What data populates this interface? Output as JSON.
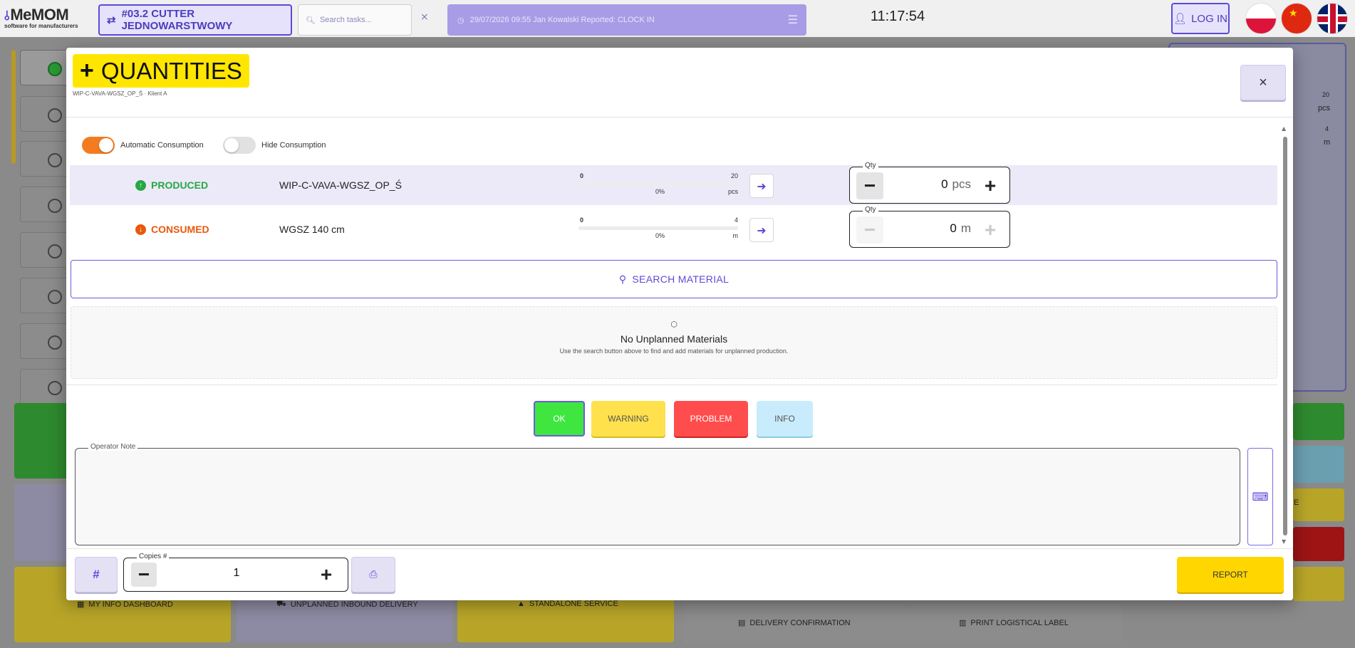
{
  "topbar": {
    "logo_brand": "MeMOM",
    "logo_tagline": "software for manufacturers",
    "workstation_label": "#03.2 CUTTER JEDNOWARSTWOWY",
    "search_placeholder": "Search tasks...",
    "notice_text": "29/07/2026 09:55 Jan Kowalski Reported: CLOCK IN",
    "clock": "11:17:54",
    "login_label": "LOG IN"
  },
  "background": {
    "right_panel_values": [
      "20",
      "pcs",
      "4",
      "m"
    ],
    "tiles": {
      "my_info_dashboard": "MY INFO DASHBOARD",
      "unplanned_inbound_delivery": "UNPLANNED INBOUND DELIVERY",
      "standalone_service": "STANDALONE SERVICE",
      "delivery_confirmation": "DELIVERY CONFIRMATION",
      "print_logistical_label": "PRINT LOGISTICAL LABEL",
      "partial_label": "E"
    }
  },
  "modal": {
    "title": "QUANTITIES",
    "subtitle": "WIP-C-VAVA-WGSZ_OP_Ś · Klient A",
    "close_label": "×"
  },
  "toggles": {
    "automatic_consumption": {
      "label": "Automatic Consumption",
      "on": true
    },
    "hide_consumption": {
      "label": "Hide Consumption",
      "on": false
    }
  },
  "materials": [
    {
      "direction": "PRODUCED",
      "name": "WIP-C-VAVA-WGSZ_OP_Ś",
      "progress_min": "0",
      "progress_max": "20",
      "progress_percent": "0%",
      "progress_fraction": 0,
      "progress_unit": "pcs",
      "qty_label": "Qty",
      "qty_value": "0",
      "qty_unit": "pcs"
    },
    {
      "direction": "CONSUMED",
      "name": "WGSZ 140 cm",
      "progress_min": "0",
      "progress_max": "4",
      "progress_percent": "0%",
      "progress_fraction": 0,
      "progress_unit": "m",
      "qty_label": "Qty",
      "qty_value": "0",
      "qty_unit": "m"
    }
  ],
  "search_material_label": "SEARCH MATERIAL",
  "empty_state": {
    "title": "No Unplanned Materials",
    "description": "Use the search button above to find and add materials for unplanned production."
  },
  "status_buttons": {
    "ok": "OK",
    "warning": "WARNING",
    "problem": "PROBLEM",
    "info": "INFO",
    "selected": "ok"
  },
  "operator_note": {
    "label": "Operator Note",
    "value": ""
  },
  "footer": {
    "hash_label": "#",
    "copies_label": "Copies #",
    "copies_value": "1",
    "report_label": "REPORT"
  },
  "colors": {
    "accent": "#5b4ad8",
    "title_yellow": "#ffe600",
    "produced": "#28a745",
    "consumed": "#e8590c",
    "toggle_on": "#f47c20"
  }
}
